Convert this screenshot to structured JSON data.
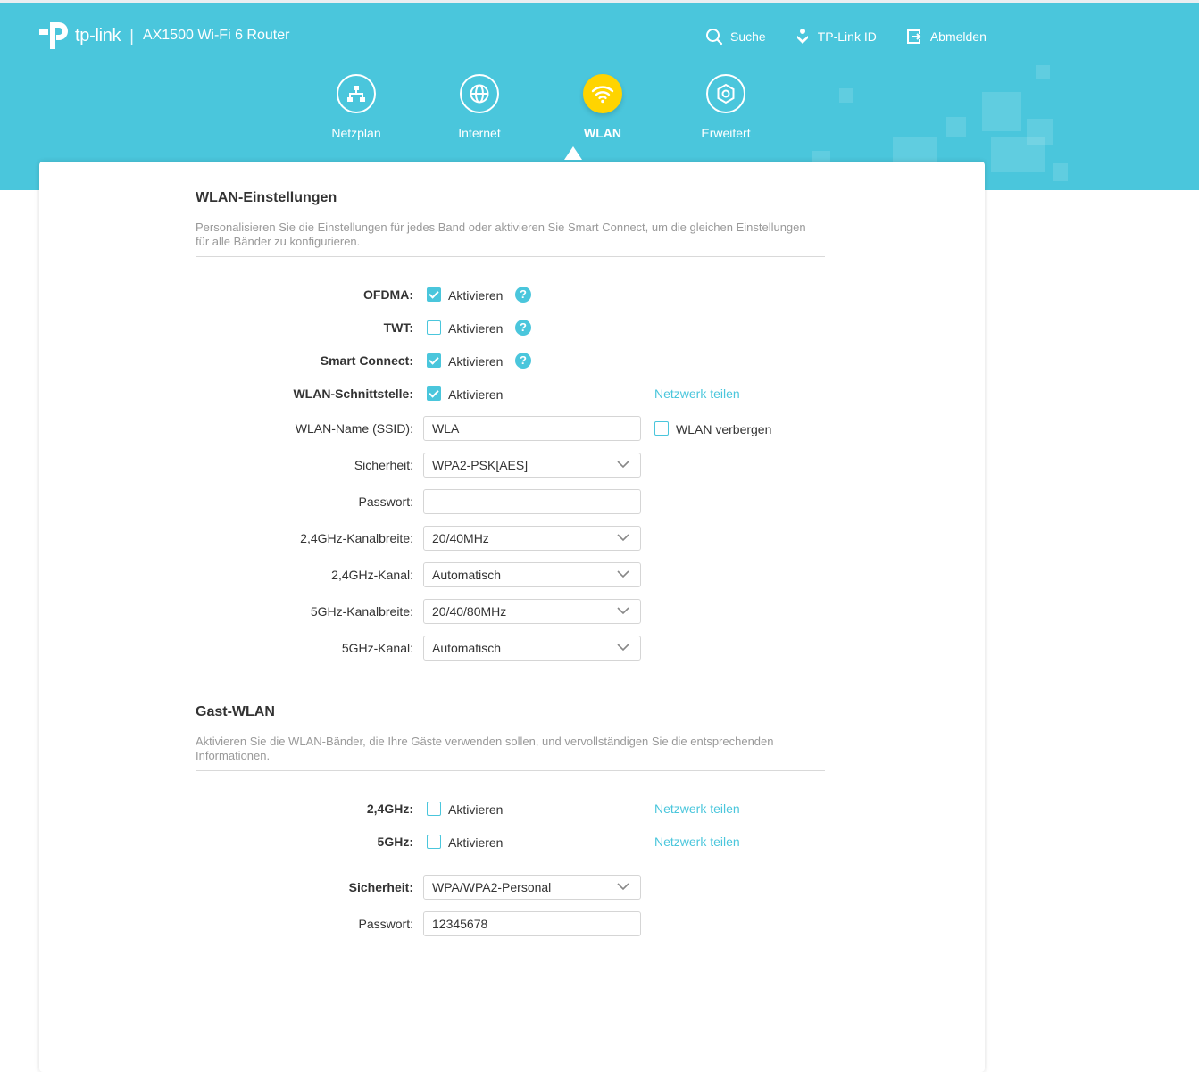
{
  "brand": {
    "logo_text": "tp-link",
    "separator": "|",
    "model": "AX1500 Wi-Fi 6 Router"
  },
  "top_actions": [
    {
      "icon": "search-icon",
      "label": "Suche"
    },
    {
      "icon": "tplink-id-icon",
      "label": "TP-Link ID"
    },
    {
      "icon": "logout-icon",
      "label": "Abmelden"
    }
  ],
  "nav": [
    {
      "icon": "network-map-icon",
      "label": "Netzplan",
      "active": false
    },
    {
      "icon": "globe-icon",
      "label": "Internet",
      "active": false
    },
    {
      "icon": "wifi-icon",
      "label": "WLAN",
      "active": true
    },
    {
      "icon": "gear-icon",
      "label": "Erweitert",
      "active": false
    }
  ],
  "wlan_settings": {
    "title": "WLAN-Einstellungen",
    "description": "Personalisieren Sie die Einstellungen für jedes Band oder aktivieren Sie Smart Connect, um die gleichen Einstellungen für alle Bänder zu konfigurieren.",
    "ofdma": {
      "label": "OFDMA",
      "checked": true,
      "option": "Aktivieren",
      "help": "?"
    },
    "twt": {
      "label": "TWT",
      "checked": false,
      "option": "Aktivieren",
      "help": "?"
    },
    "smart_connect": {
      "label": "Smart Connect",
      "checked": true,
      "option": "Aktivieren",
      "help": "?"
    },
    "interface": {
      "label": "WLAN-Schnittstelle",
      "checked": true,
      "option": "Aktivieren",
      "share_link": "Netzwerk teilen"
    },
    "ssid": {
      "label": "WLAN-Name (SSID)",
      "value": "WLA",
      "hide_label": "WLAN verbergen",
      "hide_checked": false
    },
    "security": {
      "label": "Sicherheit",
      "value": "WPA2-PSK[AES]"
    },
    "password": {
      "label": "Passwort",
      "value": ""
    },
    "bw_24": {
      "label": "2,4GHz-Kanalbreite",
      "value": "20/40MHz"
    },
    "ch_24": {
      "label": "2,4GHz-Kanal",
      "value": "Automatisch"
    },
    "bw_5": {
      "label": "5GHz-Kanalbreite",
      "value": "20/40/80MHz"
    },
    "ch_5": {
      "label": "5GHz-Kanal",
      "value": "Automatisch"
    }
  },
  "guest": {
    "title": "Gast-WLAN",
    "description": "Aktivieren Sie die WLAN-Bänder, die Ihre Gäste verwenden sollen, und vervollständigen Sie die entsprechenden Informationen.",
    "band_24": {
      "label": "2,4GHz",
      "checked": false,
      "option": "Aktivieren",
      "share_link": "Netzwerk teilen"
    },
    "band_5": {
      "label": "5GHz",
      "checked": false,
      "option": "Aktivieren",
      "share_link": "Netzwerk teilen"
    },
    "security": {
      "label": "Sicherheit",
      "value": "WPA/WPA2-Personal"
    },
    "password": {
      "label": "Passwort",
      "value": "12345678"
    }
  },
  "colors": {
    "header": "#4ac6dc",
    "accent": "#4ac6dc",
    "active_nav": "#ffd400"
  }
}
